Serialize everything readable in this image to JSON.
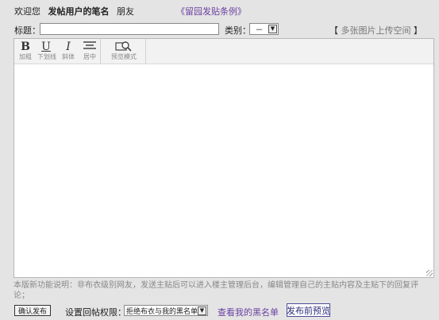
{
  "header": {
    "welcome": "欢迎您",
    "pen_name": "发帖用户的笔名",
    "friend": "朋友",
    "rules_link": "《留园发贴条例》"
  },
  "form": {
    "title_label": "标题：",
    "title_value": "",
    "category_label": "类别：",
    "category_value": "－",
    "upload_open": "【",
    "upload_text": "多张图片上传空间",
    "upload_close": "】"
  },
  "toolbar": {
    "buttons": [
      {
        "glyph": "B",
        "label": "加粗"
      },
      {
        "glyph": "U",
        "label": "下划线"
      },
      {
        "glyph": "I",
        "label": "斜体"
      },
      {
        "glyph": "",
        "label": "居中"
      },
      {
        "glyph": "",
        "label": "预览模式"
      }
    ]
  },
  "editor": {
    "content": ""
  },
  "notice": "本版新功能说明：非布衣级别网友，发送主贴后可以进入楼主管理后台，编辑管理自己的主贴内容及主贴下的回复评论；",
  "footer": {
    "confirm_label": "确认发布",
    "permission_label": "设置回帖权限：",
    "permission_value": "拒绝布衣与我的黑名单",
    "blacklist_link": "查看我的黑名单",
    "preview_label": "发布前预览"
  },
  "colors": {
    "background": "#e4e4e4",
    "link_purple": "#6a3fa0"
  }
}
